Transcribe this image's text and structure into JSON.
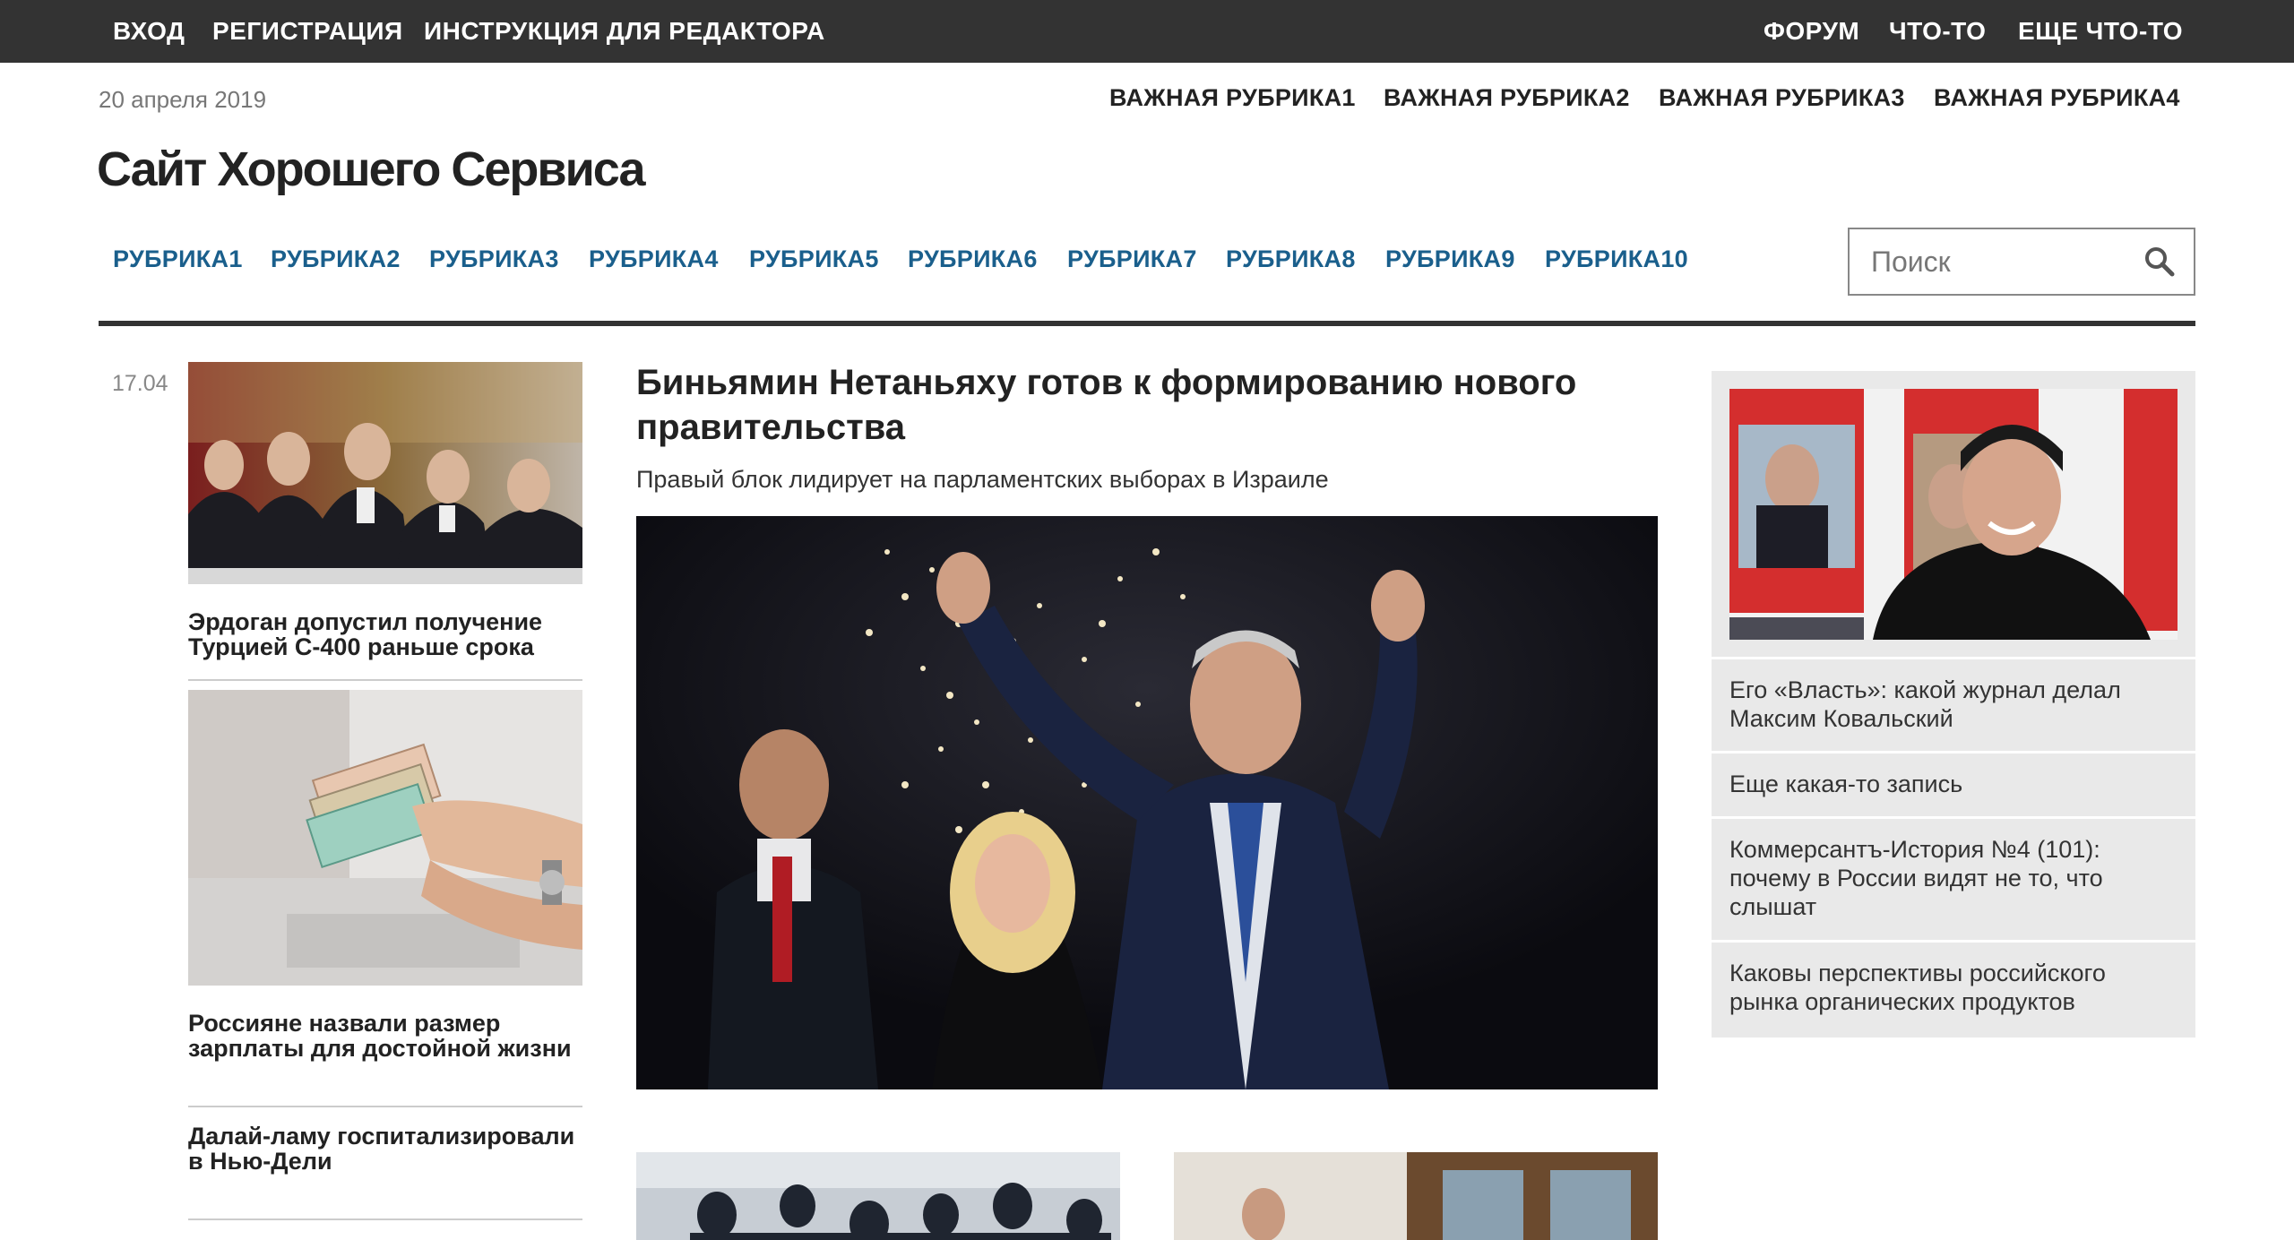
{
  "topbar": {
    "left": [
      "ВХОД",
      "РЕГИСТРАЦИЯ",
      "ИНСТРУКЦИЯ ДЛЯ РЕДАКТОРА"
    ],
    "right": [
      "ФОРУМ",
      "ЧТО-ТО",
      "ЕЩЕ ЧТО-ТО"
    ]
  },
  "header": {
    "date": "20 апреля 2019",
    "important": [
      "ВАЖНАЯ РУБРИКА1",
      "ВАЖНАЯ РУБРИКА2",
      "ВАЖНАЯ РУБРИКА3",
      "ВАЖНАЯ РУБРИКА4"
    ],
    "logo": "Сайт Хорошего Сервиса"
  },
  "rubrics": [
    "РУБРИКА1",
    "РУБРИКА2",
    "РУБРИКА3",
    "РУБРИКА4",
    "РУБРИКА5",
    "РУБРИКА6",
    "РУБРИКА7",
    "РУБРИКА8",
    "РУБРИКА9",
    "РУБРИКА10"
  ],
  "search": {
    "placeholder": "Поиск",
    "icon": "search-icon"
  },
  "left": {
    "date": "17.04",
    "items": [
      {
        "title": "Эрдоган допустил получение Турцией С-400 раньше срока"
      },
      {
        "title": "Россияне назвали размер зарплаты для достойной жизни"
      },
      {
        "title": "Далай-ламу госпитализировали в Нью-Дели"
      }
    ]
  },
  "main": {
    "title": "Биньямин Нетаньяху готов к формированию нового правительства",
    "subtitle": "Правый блок лидирует на парламентских выборах в Израиле"
  },
  "right": {
    "items": [
      "Его «Власть»: какой журнал делал Максим Ковальский",
      "Еще какая-то запись",
      "Коммерсантъ-История №4 (101): почему в России видят не то, что слышат",
      "Каковы перспективы российского рынка органических продуктов"
    ]
  },
  "colors": {
    "topbar": "#333333",
    "rubric": "#1a5f8c",
    "sidebar": "#e9e9e9"
  }
}
